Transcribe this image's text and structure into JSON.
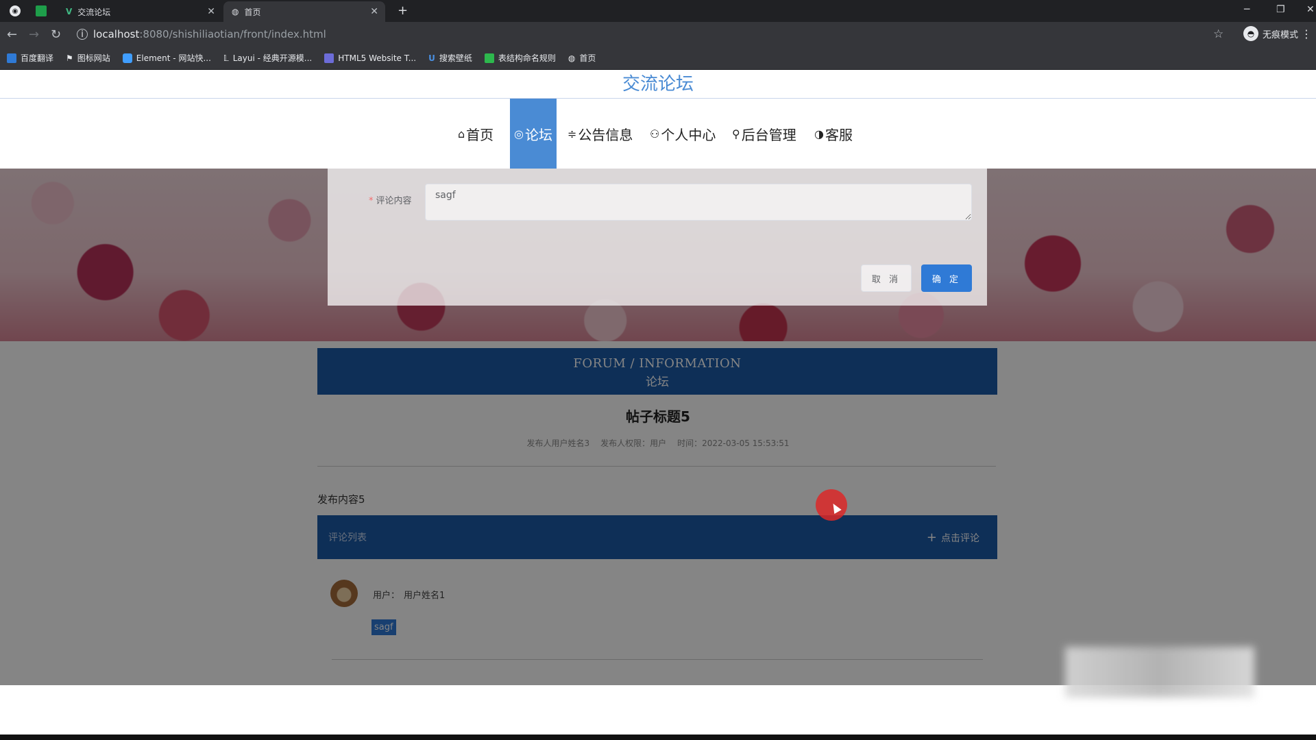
{
  "browser": {
    "tabs": [
      {
        "label": "交流论坛",
        "icon": "vue-icon"
      },
      {
        "label": "首页",
        "icon": "globe-icon"
      }
    ],
    "url_host": "localhost",
    "url_path": ":8080/shishiliaotian/front/index.html",
    "incognito_label": "无痕模式",
    "bookmarks": [
      {
        "label": "百度翻译",
        "color": "#2f7ad6"
      },
      {
        "label": "图标网站",
        "color": "#e8eaed"
      },
      {
        "label": "Element - 网站快...",
        "color": "#409eff"
      },
      {
        "label": "Layui - 经典开源模...",
        "color": "#e8eaed"
      },
      {
        "label": "HTML5 Website T...",
        "color": "#6c6cd8"
      },
      {
        "label": "搜索壁纸",
        "color": "#4a90e2"
      },
      {
        "label": "表结构命名规则",
        "color": "#2db84d"
      },
      {
        "label": "首页",
        "color": "#e8eaed"
      }
    ]
  },
  "site": {
    "title": "交流论坛",
    "nav": [
      {
        "label": "首页",
        "icon": "home-icon",
        "glyph": "⌂"
      },
      {
        "label": "论坛",
        "icon": "forum-icon",
        "glyph": "◎",
        "active": true
      },
      {
        "label": "公告信息",
        "icon": "notice-icon",
        "glyph": "≑"
      },
      {
        "label": "个人中心",
        "icon": "user-icon",
        "glyph": "⚇"
      },
      {
        "label": "后台管理",
        "icon": "link-icon",
        "glyph": "⚲"
      },
      {
        "label": "客服",
        "icon": "service-icon",
        "glyph": "◑"
      }
    ]
  },
  "dialog": {
    "field_label": "评论内容",
    "field_value": "sagf",
    "cancel_label": "取 消",
    "ok_label": "确 定"
  },
  "forum": {
    "header_en": "FORUM / INFORMATION",
    "header_zh": "论坛",
    "post_title": "帖子标题5",
    "meta_author": "发布人用户姓名3",
    "meta_role": "发布人权限：用户",
    "meta_time": "时间：2022-03-05 15:53:51",
    "post_body": "发布内容5",
    "comment_section_label": "评论列表",
    "add_comment_label": "点击评论",
    "comments": [
      {
        "user": "用户：",
        "name": "用户姓名1",
        "text": "sagf"
      }
    ]
  },
  "colors": {
    "accent": "#4a8bd4",
    "header_blue": "#1b5aa8",
    "button_blue": "#2f7ad6"
  }
}
